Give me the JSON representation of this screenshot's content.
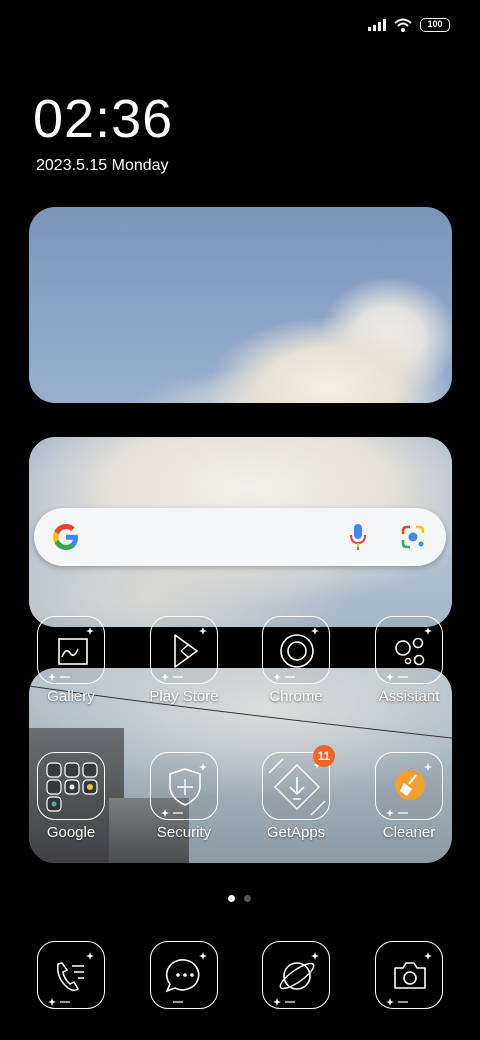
{
  "status_bar": {
    "battery": "100",
    "icons": [
      "signal-icon",
      "wifi-icon",
      "battery-icon"
    ]
  },
  "clock": {
    "time": "02:36",
    "date": "2023.5.15 Monday"
  },
  "search_widget": {
    "icons": [
      "google-g-icon",
      "microphone-icon",
      "google-lens-icon"
    ]
  },
  "apps": [
    {
      "label": "Gallery",
      "icon": "gallery-icon"
    },
    {
      "label": "Play Store",
      "icon": "play-store-icon"
    },
    {
      "label": "Chrome",
      "icon": "chrome-icon"
    },
    {
      "label": "Assistant",
      "icon": "assistant-icon"
    },
    {
      "label": "Google",
      "icon": "google-folder-icon"
    },
    {
      "label": "Security",
      "icon": "security-shield-icon"
    },
    {
      "label": "GetApps",
      "icon": "getapps-icon",
      "badge": "11"
    },
    {
      "label": "Cleaner",
      "icon": "cleaner-broom-icon"
    }
  ],
  "page_indicator": {
    "pages": 2,
    "current": 1
  },
  "dock": [
    {
      "icon": "phone-icon"
    },
    {
      "icon": "messages-icon"
    },
    {
      "icon": "browser-planet-icon"
    },
    {
      "icon": "camera-icon"
    }
  ],
  "colors": {
    "badge": "#f26522",
    "cleaner_accent": "#f0a030"
  }
}
